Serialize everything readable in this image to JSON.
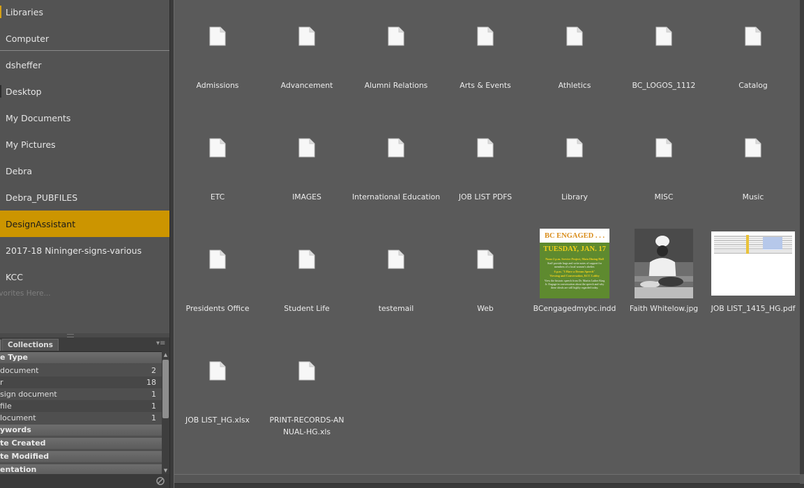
{
  "favorites": {
    "items": [
      {
        "label": "Libraries"
      },
      {
        "label": "Computer"
      },
      {
        "label": "dsheffer"
      },
      {
        "label": "Desktop"
      },
      {
        "label": "My Documents"
      },
      {
        "label": "My Pictures"
      },
      {
        "label": "Debra"
      },
      {
        "label": "Debra_PUBFILES"
      },
      {
        "label": "DesignAssistant",
        "selected": true
      },
      {
        "label": "2017-18 Nininger-signs-various"
      },
      {
        "label": "KCC"
      }
    ],
    "drag_hint": "avorites Here..."
  },
  "filter_panel": {
    "tab_label": "Collections",
    "categories": {
      "file_type": "e Type",
      "keywords": "ywords",
      "date_created": "te Created",
      "date_modified": "te Modified",
      "orientation": "entation"
    },
    "file_type_rows": [
      {
        "label": "document",
        "count": "2"
      },
      {
        "label": "r",
        "count": "18"
      },
      {
        "label": "sign document",
        "count": "1"
      },
      {
        "label": "file",
        "count": "1"
      },
      {
        "label": "locument",
        "count": "1"
      }
    ]
  },
  "content": {
    "items": [
      {
        "name": "Admissions",
        "type": "generic"
      },
      {
        "name": "Advancement",
        "type": "generic"
      },
      {
        "name": "Alumni Relations",
        "type": "generic"
      },
      {
        "name": "Arts & Events",
        "type": "generic"
      },
      {
        "name": "Athletics",
        "type": "generic"
      },
      {
        "name": "BC_LOGOS_1112",
        "type": "generic"
      },
      {
        "name": "Catalog",
        "type": "generic"
      },
      {
        "name": "ETC",
        "type": "generic"
      },
      {
        "name": "IMAGES",
        "type": "generic"
      },
      {
        "name": "International Education",
        "type": "generic"
      },
      {
        "name": "JOB LIST PDFS",
        "type": "generic"
      },
      {
        "name": "Library",
        "type": "generic"
      },
      {
        "name": "MISC",
        "type": "generic"
      },
      {
        "name": "Music",
        "type": "generic"
      },
      {
        "name": "Presidents Office",
        "type": "generic"
      },
      {
        "name": "Student Life",
        "type": "generic"
      },
      {
        "name": "testemail",
        "type": "generic"
      },
      {
        "name": "Web",
        "type": "generic"
      },
      {
        "name": "BCengagedmybc.indd",
        "type": "poster"
      },
      {
        "name": "Faith Whitelow.jpg",
        "type": "photo"
      },
      {
        "name": "JOB LIST_1415_HG.pdf",
        "type": "spreadsheet"
      },
      {
        "name": "JOB LIST_HG.xlsx",
        "type": "generic"
      },
      {
        "name": "PRINT-RECORDS-ANNUAL-HG.xls",
        "type": "generic"
      }
    ],
    "poster": {
      "headline": "BC ENGAGED . . .",
      "date": "TUESDAY, JAN. 17",
      "line1": "Noon-2 p.m.   Service Project, Main Dining Hall",
      "line2": "Staff provide hugs and write notes of support for",
      "line3": "members of a local women's shelter.",
      "line4": "6 p.m.   \"I Have a Dream Speech\"",
      "line5": "Viewing and Conversation, KCC Lobby",
      "line6": "View the historic speech from Dr. Martin Luther King",
      "line7": "Jr. Engage in conversation about the speech and why",
      "line8": "these ideals are still highly regarded today."
    },
    "colors": {
      "poster_green": "#5e8a2f",
      "poster_yellow": "#f2d11b",
      "selection": "#cc9500"
    }
  }
}
